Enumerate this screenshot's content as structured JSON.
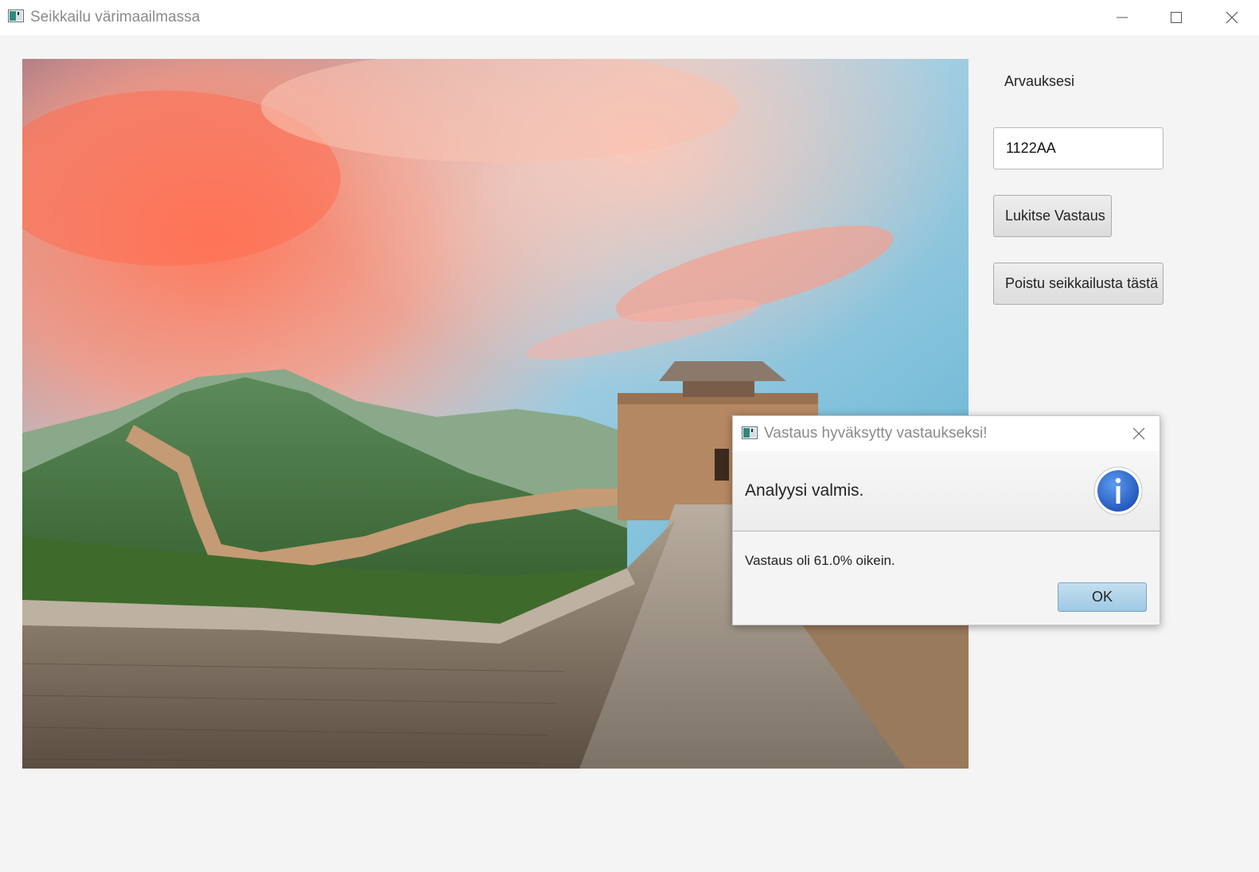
{
  "window": {
    "title": "Seikkailu värimaailmassa",
    "icon": "app-icon"
  },
  "side_panel": {
    "guess_label": "Arvauksesi",
    "guess_value": "1122AA",
    "lock_button": "Lukitse Vastaus",
    "exit_button": "Poistu seikkailusta tästä"
  },
  "scene": {
    "description_icon": "great-wall-photo"
  },
  "dialog": {
    "title": "Vastaus hyväksytty vastaukseksi!",
    "header": "Analyysi valmis.",
    "content": "Vastaus oli 61.0% oikein.",
    "ok_button": "OK",
    "header_icon": "info-icon",
    "accent_color": "#2f6fd0"
  }
}
